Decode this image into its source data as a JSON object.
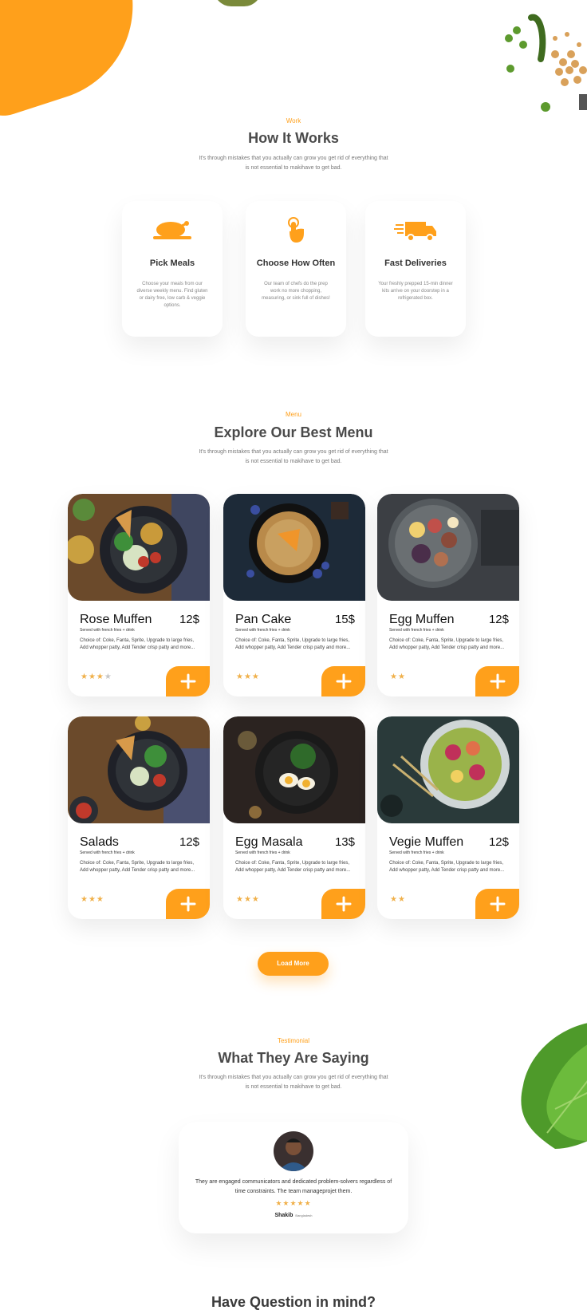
{
  "how": {
    "tag": "Work",
    "title": "How It Works",
    "subtitle": "It's through mistakes that you actually can grow you get rid of everything that is not essential to makihave to get bad.",
    "steps": [
      {
        "icon": "roast-chicken-icon",
        "title": "Pick Meals",
        "desc": "Choose your meals from our diverse weekly menu. Find gluten or dairy free, low carb & veggie options."
      },
      {
        "icon": "finger-tap-icon",
        "title": "Choose How Often",
        "desc": "Our team of chefs do the prep work no more chopping, measuring, or sink full of dishes!"
      },
      {
        "icon": "delivery-truck-icon",
        "title": "Fast Deliveries",
        "desc": "Your freshly prepped 15-min dinner kits arrive on your doorstep in a refrigerated box."
      }
    ]
  },
  "menu": {
    "tag": "Menu",
    "title": "Explore Our Best Menu",
    "subtitle": "It's through mistakes that you actually can grow you get rid of everything that is not essential to makihave to get bad.",
    "items": [
      {
        "name": "Rose Muffen",
        "price": "12$",
        "served": "Served with french fries + drink",
        "desc": "Choice of: Coke, Fanta, Sprite, Upgrade to large fries, Add whopper patty, Add Tender crisp patty and more...",
        "stars_on": "★★★",
        "stars_off": "★"
      },
      {
        "name": "Pan Cake",
        "price": "15$",
        "served": "Served with french fries + drink",
        "desc": "Choice of: Coke, Fanta, Sprite, Upgrade to large fries, Add whopper patty, Add Tender crisp patty and more...",
        "stars_on": "★★★",
        "stars_off": ""
      },
      {
        "name": "Egg Muffen",
        "price": "12$",
        "served": "Served with french fries + drink",
        "desc": "Choice of: Coke, Fanta, Sprite, Upgrade to large fries, Add whopper patty, Add Tender crisp patty and more...",
        "stars_on": "★★",
        "stars_off": ""
      },
      {
        "name": "Salads",
        "price": "12$",
        "served": "Served with french fries + drink",
        "desc": "Choice of: Coke, Fanta, Sprite, Upgrade to large fries, Add whopper patty, Add Tender crisp patty and more...",
        "stars_on": "★★★",
        "stars_off": ""
      },
      {
        "name": "Egg Masala",
        "price": "13$",
        "served": "Served with french fries + drink",
        "desc": "Choice of: Coke, Fanta, Sprite, Upgrade to large fries, Add whopper patty, Add Tender crisp patty and more...",
        "stars_on": "★★★",
        "stars_off": ""
      },
      {
        "name": "Vegie Muffen",
        "price": "12$",
        "served": "Served with french fries + drink",
        "desc": "Choice of: Coke, Fanta, Sprite, Upgrade to large fries, Add whopper patty, Add Tender crisp patty and more...",
        "stars_on": "★★",
        "stars_off": ""
      }
    ],
    "add_symbol": "+",
    "load_more": "Load More"
  },
  "testimonial": {
    "tag": "Testimonial",
    "title": "What They Are Saying",
    "subtitle": "It's through mistakes that you actually can grow you get rid of everything that is not essential to makihave to get bad.",
    "quote": "They are engaged communicators and dedicated problem-solvers regardless of time constraints. The team manageprojet them.",
    "stars": "★★★★★",
    "author": "Shakib",
    "location": "Bangladesh"
  },
  "question": {
    "title": "Have Question in mind?"
  },
  "colors": {
    "accent": "#ffa01b",
    "star": "#f0b04a",
    "text": "#3a3a3a"
  }
}
